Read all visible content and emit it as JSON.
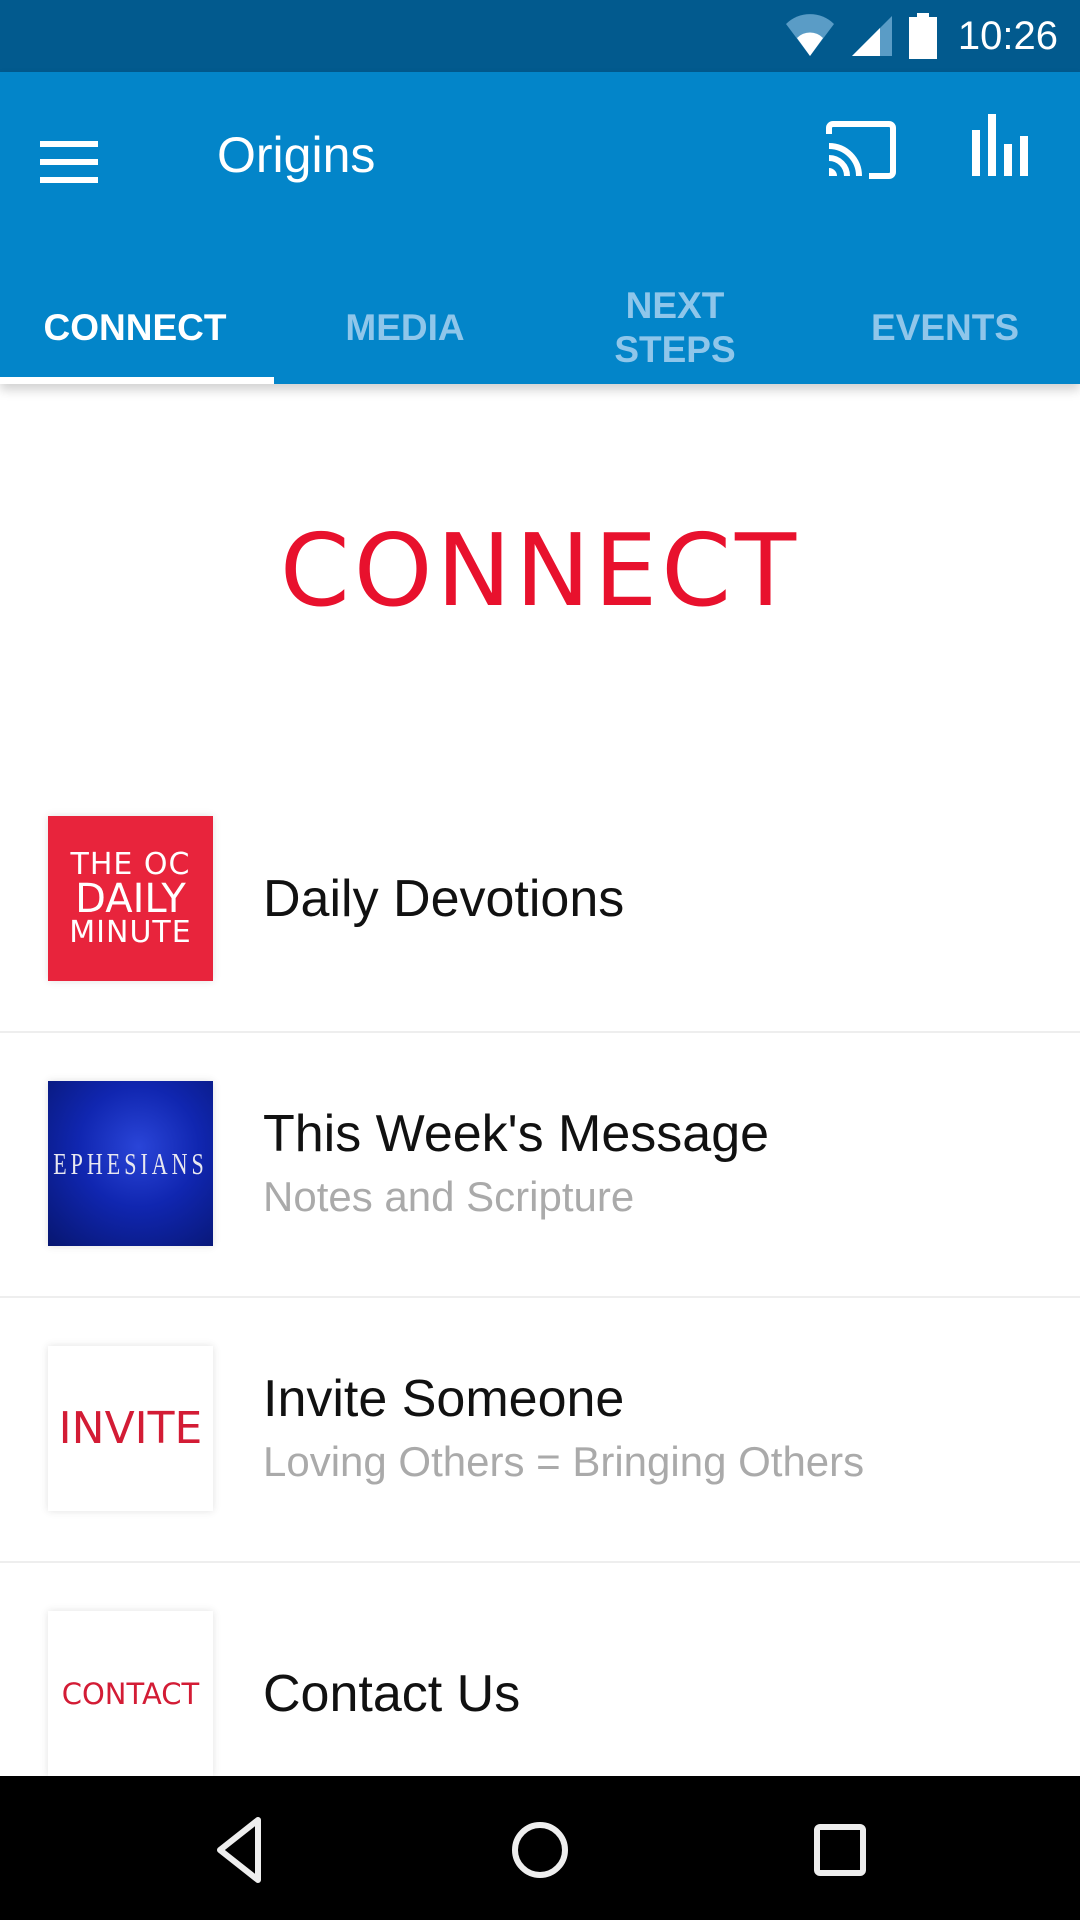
{
  "status_bar": {
    "time": "10:26",
    "icons": [
      "wifi-icon",
      "cell-signal-icon",
      "battery-icon"
    ]
  },
  "app_bar": {
    "title": "Origins",
    "menu_icon": "hamburger-menu-icon",
    "actions": [
      "cast-icon",
      "bar-chart-icon"
    ]
  },
  "tabs": [
    {
      "label": "CONNECT",
      "active": true
    },
    {
      "label": "MEDIA",
      "active": false
    },
    {
      "label": "NEXT STEPS",
      "active": false
    },
    {
      "label": "EVENTS",
      "active": false
    }
  ],
  "hero": {
    "text": "CONNECT",
    "color": "#e8112d"
  },
  "list": [
    {
      "title": "Daily Devotions",
      "subtitle": "",
      "thumb": {
        "lines": [
          "THE OC",
          "DAILY",
          "MINUTE"
        ],
        "bg": "#e8243c",
        "fg": "#ffffff"
      }
    },
    {
      "title": "This Week's Message",
      "subtitle": "Notes and Scripture",
      "thumb": {
        "lines": [
          "EPHESIANS"
        ],
        "bg": "#0d1f9c",
        "fg": "#e8e8f0"
      }
    },
    {
      "title": "Invite Someone",
      "subtitle": "Loving Others = Bringing Others",
      "thumb": {
        "lines": [
          "INVITE"
        ],
        "bg": "#ffffff",
        "fg": "#d31c35"
      }
    },
    {
      "title": "Contact Us",
      "subtitle": "",
      "thumb": {
        "lines": [
          "CONTACT"
        ],
        "bg": "#ffffff",
        "fg": "#d31c35"
      }
    }
  ],
  "nav_bar": {
    "buttons": [
      "back-icon",
      "home-icon",
      "recents-icon"
    ]
  },
  "colors": {
    "status_bar": "#025a8e",
    "app_bar": "#0385c9",
    "tab_inactive": "#8fc6ea"
  }
}
